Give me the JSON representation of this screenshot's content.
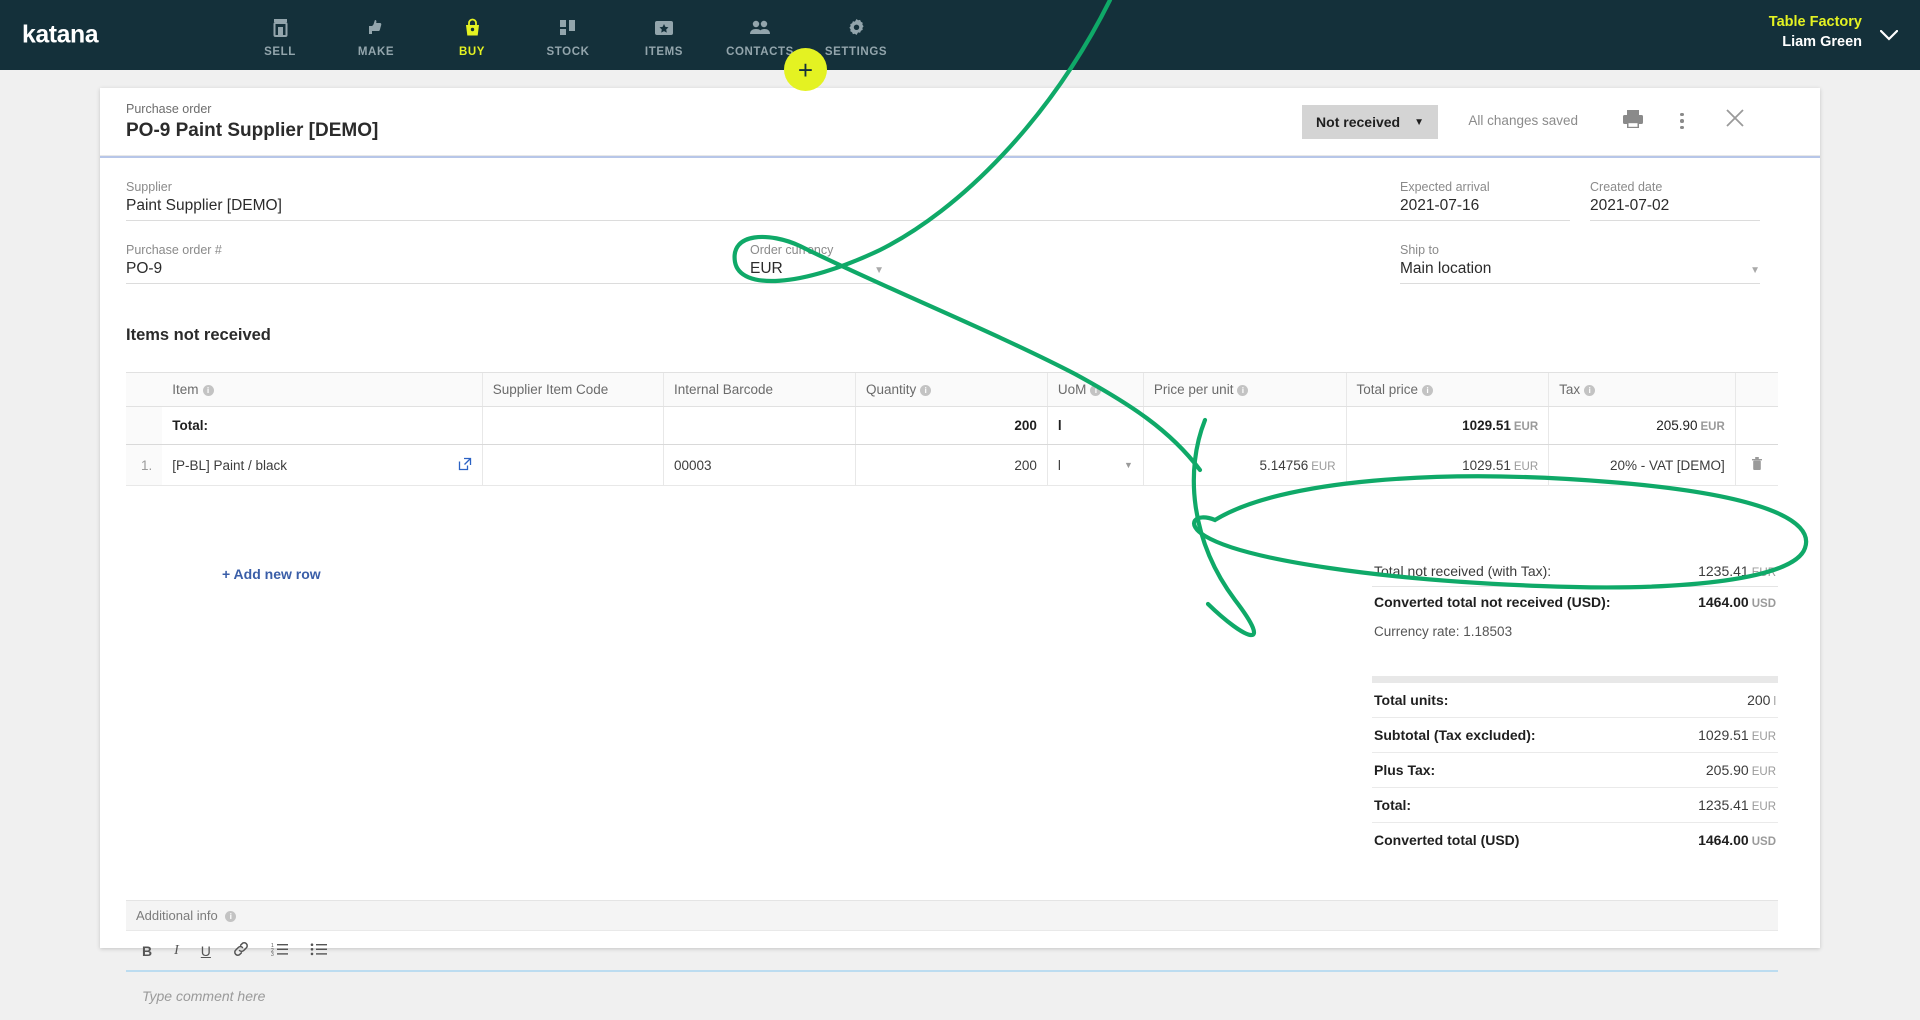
{
  "nav": {
    "brand": "katana",
    "items": [
      {
        "label": "SELL",
        "icon": "store-icon",
        "active": false
      },
      {
        "label": "MAKE",
        "icon": "thumbs-icon",
        "active": false
      },
      {
        "label": "BUY",
        "icon": "basket-icon",
        "active": true
      },
      {
        "label": "STOCK",
        "icon": "blocks-icon",
        "active": false
      },
      {
        "label": "ITEMS",
        "icon": "ticket-icon",
        "active": false
      },
      {
        "label": "CONTACTS",
        "icon": "people-icon",
        "active": false
      },
      {
        "label": "SETTINGS",
        "icon": "gear-icon",
        "active": false
      }
    ],
    "add_button": "+",
    "user": {
      "company": "Table Factory",
      "name": "Liam Green",
      "chevron": "⌄"
    },
    "accent_color": "#e4f222",
    "bar_color": "#14303a"
  },
  "card": {
    "breadcrumb": "Purchase order",
    "title": "PO-9 Paint Supplier [DEMO]",
    "status": "Not received",
    "status_caret": "▼",
    "saved_text": "All changes saved",
    "print_icon": "printer-icon",
    "more_icon": "more-vertical-icon",
    "close_icon": "close-icon"
  },
  "form": {
    "supplier": {
      "label": "Supplier",
      "value": "Paint Supplier [DEMO]"
    },
    "po_number": {
      "label": "Purchase order #",
      "value": "PO-9"
    },
    "currency": {
      "label": "Order currency",
      "value": "EUR",
      "caret": "▼"
    },
    "arrival": {
      "label": "Expected arrival",
      "value": "2021-07-16"
    },
    "created": {
      "label": "Created date",
      "value": "2021-07-02"
    },
    "ship_to": {
      "label": "Ship to",
      "value": "Main location",
      "caret": "▼"
    }
  },
  "items_section": {
    "title": "Items not received",
    "add_row_label": "+ Add new row",
    "columns": [
      {
        "key": "num",
        "label": "",
        "info": false
      },
      {
        "key": "item",
        "label": "Item",
        "info": true
      },
      {
        "key": "sic",
        "label": "Supplier Item Code",
        "info": false
      },
      {
        "key": "bar",
        "label": "Internal Barcode",
        "info": false
      },
      {
        "key": "qty",
        "label": "Quantity",
        "info": true
      },
      {
        "key": "uom",
        "label": "UoM",
        "info": true
      },
      {
        "key": "ppu",
        "label": "Price per unit",
        "info": true
      },
      {
        "key": "tot",
        "label": "Total price",
        "info": true
      },
      {
        "key": "tax",
        "label": "Tax",
        "info": true
      },
      {
        "key": "del",
        "label": "",
        "info": false
      }
    ],
    "total_row": {
      "label": "Total:",
      "quantity": "200",
      "uom": "l",
      "total_price": "1029.51",
      "total_price_currency": "EUR",
      "tax": "205.90",
      "tax_currency": "EUR"
    },
    "rows": [
      {
        "num": "1.",
        "item": "[P-BL] Paint / black",
        "item_link_icon": "external-link-icon",
        "supplier_item_code": "",
        "internal_barcode": "00003",
        "quantity": "200",
        "uom": "l",
        "uom_caret": "▼",
        "price_per_unit": "5.14756",
        "price_currency": "EUR",
        "total_price": "1029.51",
        "total_currency": "EUR",
        "tax": "20% - VAT [DEMO]",
        "delete_icon": "trash-icon"
      }
    ]
  },
  "summary_not_received": [
    {
      "label": "Total not received (with Tax):",
      "value": "1235.41",
      "currency": "EUR",
      "bold": false,
      "line": false
    },
    {
      "label": "Converted total not received (USD):",
      "value": "1464.00",
      "currency": "USD",
      "bold": true,
      "line": true
    }
  ],
  "currency_rate_note": "Currency rate: 1.18503",
  "summary_totals": [
    {
      "label": "Total units:",
      "value": "200",
      "currency": "l",
      "bold_value": false
    },
    {
      "label": "Subtotal (Tax excluded):",
      "value": "1029.51",
      "currency": "EUR",
      "bold_value": false
    },
    {
      "label": "Plus Tax:",
      "value": "205.90",
      "currency": "EUR",
      "bold_value": false
    },
    {
      "label": "Total:",
      "value": "1235.41",
      "currency": "EUR",
      "bold_value": false
    },
    {
      "label": "Converted total (USD)",
      "value": "1464.00",
      "currency": "USD",
      "bold_value": true
    }
  ],
  "additional_info": {
    "label": "Additional info",
    "toolbar": [
      {
        "name": "bold-icon",
        "glyph": "B"
      },
      {
        "name": "italic-icon",
        "glyph": "I"
      },
      {
        "name": "underline-icon",
        "glyph": "U"
      },
      {
        "name": "link-icon",
        "glyph": "ὑ7"
      },
      {
        "name": "ordered-list-icon",
        "glyph": "☰"
      },
      {
        "name": "bullet-list-icon",
        "glyph": "☰"
      }
    ],
    "placeholder": "Type comment here"
  },
  "annotation": {
    "color": "#0fa968",
    "description": "hand-drawn highlight circling Order currency EUR and Converted total not received (USD)"
  }
}
